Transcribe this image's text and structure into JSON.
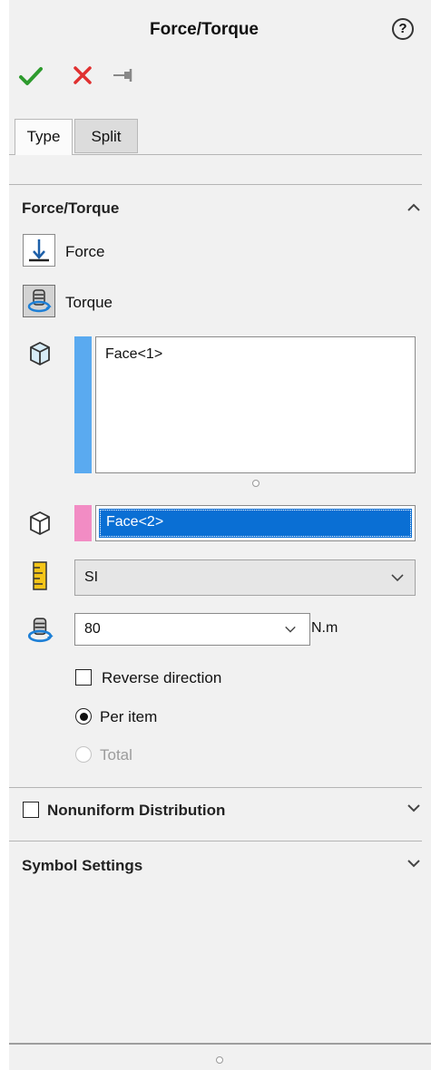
{
  "header": {
    "title": "Force/Torque",
    "help_glyph": "?"
  },
  "tabs": [
    {
      "label": "Type"
    },
    {
      "label": "Split"
    }
  ],
  "force_torque_section": {
    "title": "Force/Torque",
    "options": [
      {
        "label": "Force",
        "icon": "force-arrow-icon",
        "selected": false
      },
      {
        "label": "Torque",
        "icon": "torque-icon",
        "selected": true
      }
    ],
    "faces_list": {
      "items": [
        "Face<1>"
      ],
      "bar_color": "#5aaaf0"
    },
    "direction_field": {
      "value": "Face<2>",
      "bar_color": "#f28cc4"
    },
    "units": {
      "selected": "SI"
    },
    "torque_value": {
      "value": "80",
      "unit": "N.m"
    },
    "reverse_direction": {
      "label": "Reverse direction",
      "checked": false
    },
    "per_item": {
      "label": "Per item",
      "selected": true
    },
    "total": {
      "label": "Total",
      "selected": false,
      "disabled": true
    }
  },
  "nonuniform_section": {
    "label": "Nonuniform Distribution",
    "checked": false
  },
  "symbol_section": {
    "title": "Symbol Settings"
  },
  "colors": {
    "ok": "#2e9b2e",
    "cancel": "#e03030",
    "selection": "#0a6fd4"
  }
}
